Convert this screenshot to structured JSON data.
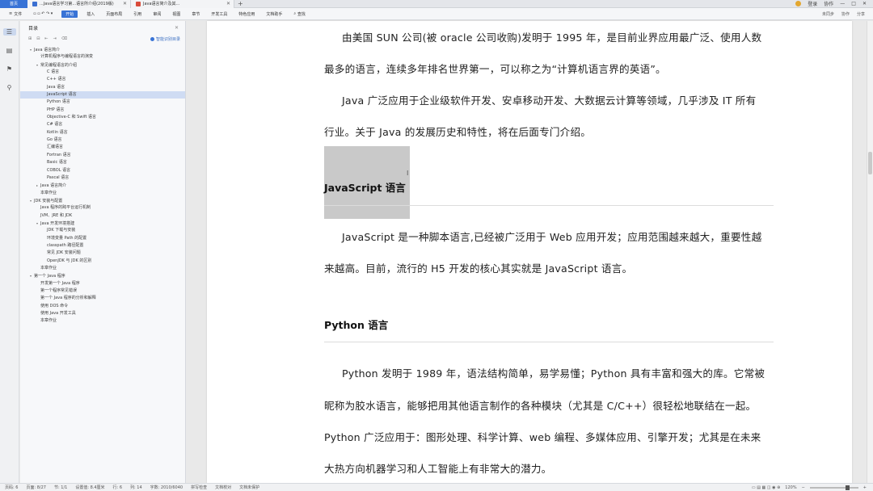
{
  "titlebar": {
    "home_label": "首页",
    "tabs": [
      {
        "label": "...Java语言学习第...语言所介绍(2019版)",
        "color": "#3a6fd1"
      },
      {
        "label": "Java语言简介及其...",
        "color": "#d94b3a"
      }
    ],
    "new_tab": "+",
    "user": "登录",
    "share": "协作",
    "controls": [
      "—",
      "□",
      "✕"
    ]
  },
  "ribbon": {
    "file": "文件",
    "items": [
      "开始",
      "插入",
      "页面布局",
      "引用",
      "审阅",
      "视图",
      "章节",
      "开发工具",
      "特色应用",
      "文档助手",
      "查找"
    ],
    "active_index": 0,
    "right": [
      "未同步",
      "协作",
      "分享"
    ]
  },
  "nav": {
    "title": "目录",
    "smart": "智能识别目录",
    "items": [
      {
        "label": "Java 语言简介",
        "level": 0,
        "toggle": "▾"
      },
      {
        "label": "计算机程序与编程语言的演变",
        "level": 1,
        "toggle": ""
      },
      {
        "label": "常见编程语言的介绍",
        "level": 1,
        "toggle": "▾"
      },
      {
        "label": "C 语言",
        "level": 2,
        "toggle": ""
      },
      {
        "label": "C++ 语言",
        "level": 2,
        "toggle": ""
      },
      {
        "label": "Java 语言",
        "level": 2,
        "toggle": ""
      },
      {
        "label": "JavaScript 语言",
        "level": 2,
        "toggle": "",
        "selected": true
      },
      {
        "label": "Python 语言",
        "level": 2,
        "toggle": ""
      },
      {
        "label": "PHP 语言",
        "level": 2,
        "toggle": ""
      },
      {
        "label": "Objective-C 和 Swift 语言",
        "level": 2,
        "toggle": ""
      },
      {
        "label": "C# 语言",
        "level": 2,
        "toggle": ""
      },
      {
        "label": "Kotlin 语言",
        "level": 2,
        "toggle": ""
      },
      {
        "label": "Go 语言",
        "level": 2,
        "toggle": ""
      },
      {
        "label": "汇编语言",
        "level": 2,
        "toggle": ""
      },
      {
        "label": "Fortran 语言",
        "level": 2,
        "toggle": ""
      },
      {
        "label": "Basic 语言",
        "level": 2,
        "toggle": ""
      },
      {
        "label": "COBOL 语言",
        "level": 2,
        "toggle": ""
      },
      {
        "label": "Pascal 语言",
        "level": 2,
        "toggle": ""
      },
      {
        "label": "Java 语言简介",
        "level": 1,
        "toggle": "▸"
      },
      {
        "label": "本章作业",
        "level": 1,
        "toggle": ""
      },
      {
        "label": "JDK 安装与配置",
        "level": 0,
        "toggle": "▾"
      },
      {
        "label": "Java 程序的跨平台运行机制",
        "level": 1,
        "toggle": ""
      },
      {
        "label": "JVM、JRE 和 JDK",
        "level": 1,
        "toggle": ""
      },
      {
        "label": "Java 开发环境搭建",
        "level": 1,
        "toggle": "▾"
      },
      {
        "label": "JDK 下载与安装",
        "level": 2,
        "toggle": ""
      },
      {
        "label": "环境变量 Path 的配置",
        "level": 2,
        "toggle": ""
      },
      {
        "label": "classpath 路径配置",
        "level": 2,
        "toggle": ""
      },
      {
        "label": "常见 JDK 安装问题",
        "level": 2,
        "toggle": ""
      },
      {
        "label": "OpenJDK 与 JDK 的区别",
        "level": 2,
        "toggle": ""
      },
      {
        "label": "本章作业",
        "level": 1,
        "toggle": ""
      },
      {
        "label": "第一个 Java 程序",
        "level": 0,
        "toggle": "▾"
      },
      {
        "label": "开发第一个 Java 程序",
        "level": 1,
        "toggle": ""
      },
      {
        "label": "第一个程序常见错误",
        "level": 1,
        "toggle": ""
      },
      {
        "label": "第一个 Java 程序的分析和解释",
        "level": 1,
        "toggle": ""
      },
      {
        "label": "使用 DOS 命令",
        "level": 1,
        "toggle": ""
      },
      {
        "label": "使用 Java 开发工具",
        "level": 1,
        "toggle": ""
      },
      {
        "label": "本章作业",
        "level": 1,
        "toggle": ""
      }
    ]
  },
  "document": {
    "paragraphs": [
      {
        "text": "由美国 SUN 公司(被 oracle 公司收购)发明于 1995 年，是目前业界应用最广泛、使用人数",
        "indent": true
      },
      {
        "text": "最多的语言，连续多年排名世界第一，可以称之为“计算机语言界的英语”。",
        "indent": false
      },
      {
        "text": "Java 广泛应用于企业级软件开发、安卓移动开发、大数据云计算等领域，几乎涉及 IT 所有",
        "indent": true
      },
      {
        "text": "行业。关于 Java 的发展历史和特性，将在后面专门介绍。",
        "indent": false
      },
      {
        "text": "JavaScript 是一种脚本语言,已经被广泛用于 Web 应用开发；应用范围越来越大，重要性越",
        "indent": true
      },
      {
        "text": "来越高。目前，流行的 H5 开发的核心其实就是 JavaScript 语言。",
        "indent": false
      },
      {
        "text": "Python 发明于 1989 年，语法结构简单，易学易懂；Python 具有丰富和强大的库。它常被",
        "indent": true
      },
      {
        "text": "昵称为胶水语言，能够把用其他语言制作的各种模块（尤其是 C/C++）很轻松地联结在一起。",
        "indent": false
      },
      {
        "text": "Python 广泛应用于：图形处理、科学计算、web 编程、多媒体应用、引擎开发；尤其是在未来",
        "indent": false
      },
      {
        "text": "大热方向机器学习和人工智能上有非常大的潜力。",
        "indent": false
      }
    ],
    "headings": [
      "JavaScript 语言",
      "Python 语言"
    ]
  },
  "status": {
    "left": [
      "页码: 6",
      "页面: 8/27",
      "节: 1/1",
      "设置值: 8.4厘米",
      "行: 6",
      "列: 14",
      "字数: 2010/6040",
      "拼写检查",
      "文档校对",
      "文档未保护"
    ],
    "zoom": "120%"
  }
}
